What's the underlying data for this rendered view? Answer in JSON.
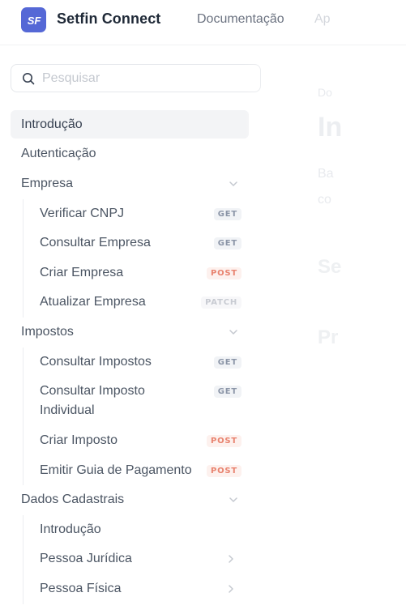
{
  "header": {
    "logo_text": "SF",
    "brand": "Setfin Connect",
    "nav": [
      {
        "label": "Documentação"
      },
      {
        "label": "Ap"
      }
    ]
  },
  "search": {
    "placeholder": "Pesquisar"
  },
  "sidebar": {
    "items": [
      {
        "label": "Introdução",
        "active": true
      },
      {
        "label": "Autenticação"
      }
    ],
    "groups": [
      {
        "label": "Empresa",
        "expanded": true,
        "children": [
          {
            "label": "Verificar CNPJ",
            "method": "GET"
          },
          {
            "label": "Consultar Empresa",
            "method": "GET"
          },
          {
            "label": "Criar Empresa",
            "method": "POST"
          },
          {
            "label": "Atualizar Empresa",
            "method": "PATCH"
          }
        ]
      },
      {
        "label": "Impostos",
        "expanded": true,
        "children": [
          {
            "label": "Consultar Impostos",
            "method": "GET"
          },
          {
            "label": "Consultar Imposto Individual",
            "method": "GET"
          },
          {
            "label": "Criar Imposto",
            "method": "POST"
          },
          {
            "label": "Emitir Guia de Pagamento",
            "method": "POST"
          }
        ]
      },
      {
        "label": "Dados Cadastrais",
        "expanded": true,
        "children": [
          {
            "label": "Introdução"
          },
          {
            "label": "Pessoa Jurídica",
            "has_children": true
          },
          {
            "label": "Pessoa Física",
            "has_children": true
          }
        ]
      }
    ]
  },
  "main": {
    "breadcrumb": "Do",
    "title": "In",
    "paragraph_line1": "Ba",
    "paragraph_line2": "co",
    "section1": "Se",
    "section2": "Pr"
  },
  "colors": {
    "accent": "#5568d6",
    "get": "#8b95a7",
    "post": "#e8836f",
    "patch": "#c8cbd2"
  }
}
